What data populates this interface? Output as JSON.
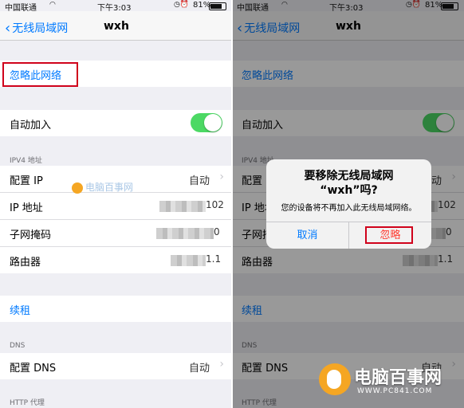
{
  "status": {
    "carrier": "中国联通",
    "time": "下午3:03",
    "battery": "81%"
  },
  "nav": {
    "back_label": "无线局域网",
    "title": "wxh"
  },
  "forget_network": "忽略此网络",
  "auto_join": {
    "label": "自动加入",
    "on": true
  },
  "ipv4": {
    "header": "IPV4 地址",
    "rows": [
      {
        "label": "配置 IP",
        "value": "自动"
      },
      {
        "label": "IP 地址",
        "value_suffix": "102"
      },
      {
        "label": "子网掩码",
        "value_suffix": "0"
      },
      {
        "label": "路由器",
        "value_suffix": "1.1"
      }
    ]
  },
  "renew": "续租",
  "dns": {
    "header": "DNS",
    "row_label": "配置 DNS",
    "row_value": "自动"
  },
  "http_proxy": {
    "header": "HTTP 代理"
  },
  "alert": {
    "title_line1": "要移除无线局域网",
    "title_line2": "“wxh”吗?",
    "message": "您的设备将不再加入此无线局域网络。",
    "cancel": "取消",
    "ignore": "忽略"
  },
  "watermark": {
    "small": "电脑百事网",
    "brand": "电脑百事网",
    "url": "WWW.PC841.COM"
  },
  "colors": {
    "accent": "#007aff",
    "toggle_on": "#4cd964",
    "highlight": "#d0021b"
  }
}
